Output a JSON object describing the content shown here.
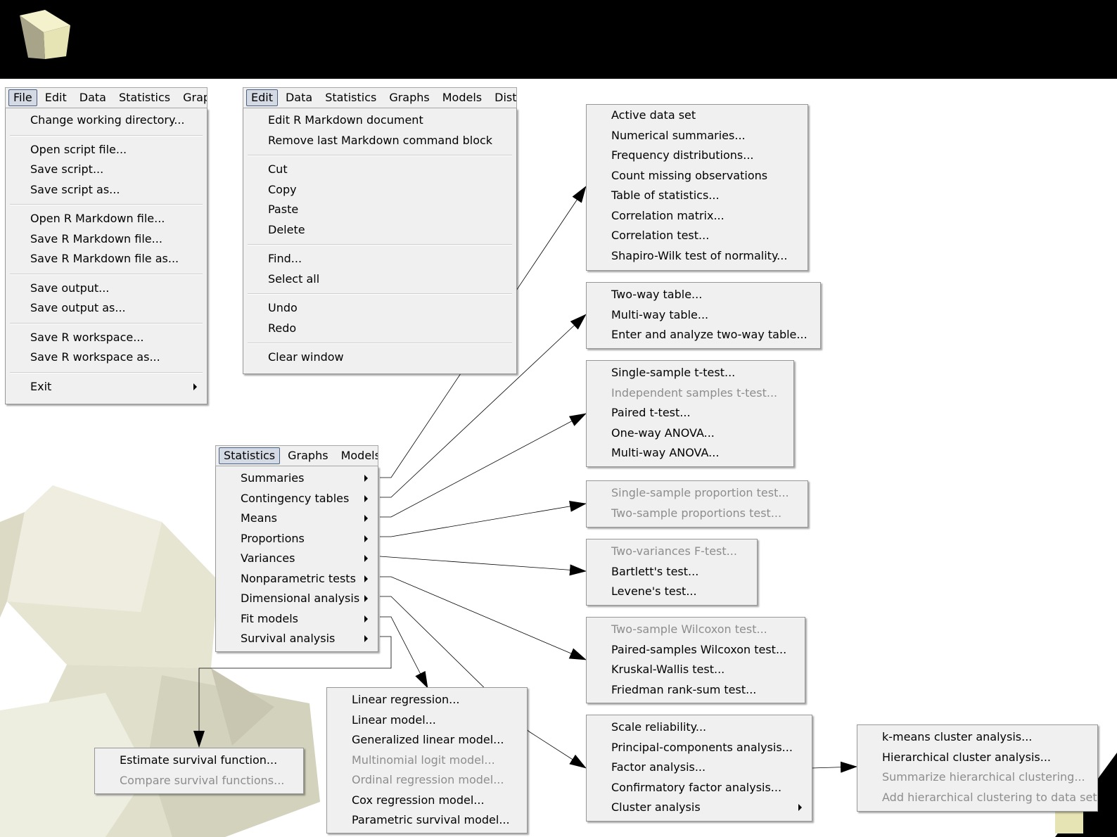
{
  "file_menu": {
    "menubar": [
      "File",
      "Edit",
      "Data",
      "Statistics",
      "Graphs"
    ],
    "items": [
      {
        "label": "Change working directory..."
      },
      {
        "sep": true
      },
      {
        "label": "Open script file..."
      },
      {
        "label": "Save script..."
      },
      {
        "label": "Save script as..."
      },
      {
        "sep": true
      },
      {
        "label": "Open R Markdown file..."
      },
      {
        "label": "Save R Markdown file..."
      },
      {
        "label": "Save R Markdown file as..."
      },
      {
        "sep": true
      },
      {
        "label": "Save output..."
      },
      {
        "label": "Save output as..."
      },
      {
        "sep": true
      },
      {
        "label": "Save R workspace..."
      },
      {
        "label": "Save R workspace as..."
      },
      {
        "sep": true
      },
      {
        "label": "Exit",
        "submenu": true
      }
    ]
  },
  "edit_menu": {
    "menubar": [
      "Edit",
      "Data",
      "Statistics",
      "Graphs",
      "Models",
      "Distributions"
    ],
    "items": [
      {
        "label": "Edit R Markdown document"
      },
      {
        "label": "Remove last Markdown command block"
      },
      {
        "sep": true
      },
      {
        "label": "Cut"
      },
      {
        "label": "Copy"
      },
      {
        "label": "Paste"
      },
      {
        "label": "Delete"
      },
      {
        "sep": true
      },
      {
        "label": "Find..."
      },
      {
        "label": "Select all"
      },
      {
        "sep": true
      },
      {
        "label": "Undo"
      },
      {
        "label": "Redo"
      },
      {
        "sep": true
      },
      {
        "label": "Clear window"
      }
    ]
  },
  "statistics_menu": {
    "menubar": [
      "Statistics",
      "Graphs",
      "Models"
    ],
    "items": [
      {
        "label": "Summaries",
        "submenu": true
      },
      {
        "label": "Contingency tables",
        "submenu": true
      },
      {
        "label": "Means",
        "submenu": true
      },
      {
        "label": "Proportions",
        "submenu": true
      },
      {
        "label": "Variances",
        "submenu": true
      },
      {
        "label": "Nonparametric tests",
        "submenu": true
      },
      {
        "label": "Dimensional analysis",
        "submenu": true
      },
      {
        "label": "Fit models",
        "submenu": true
      },
      {
        "label": "Survival analysis",
        "submenu": true
      }
    ]
  },
  "submenus": {
    "summaries": [
      {
        "label": "Active data set"
      },
      {
        "label": "Numerical summaries..."
      },
      {
        "label": "Frequency distributions..."
      },
      {
        "label": "Count missing observations"
      },
      {
        "label": "Table of statistics..."
      },
      {
        "label": "Correlation matrix..."
      },
      {
        "label": "Correlation test..."
      },
      {
        "label": "Shapiro-Wilk test of normality..."
      }
    ],
    "contingency": [
      {
        "label": "Two-way table..."
      },
      {
        "label": "Multi-way table..."
      },
      {
        "label": "Enter and analyze two-way table..."
      }
    ],
    "means": [
      {
        "label": "Single-sample t-test..."
      },
      {
        "label": "Independent samples t-test...",
        "disabled": true
      },
      {
        "label": "Paired t-test..."
      },
      {
        "label": "One-way ANOVA..."
      },
      {
        "label": "Multi-way ANOVA..."
      }
    ],
    "proportions": [
      {
        "label": "Single-sample proportion test...",
        "disabled": true
      },
      {
        "label": "Two-sample proportions test...",
        "disabled": true
      }
    ],
    "variances": [
      {
        "label": "Two-variances F-test...",
        "disabled": true
      },
      {
        "label": "Bartlett's test..."
      },
      {
        "label": "Levene's test..."
      }
    ],
    "nonparametric": [
      {
        "label": "Two-sample Wilcoxon test...",
        "disabled": true
      },
      {
        "label": "Paired-samples Wilcoxon test..."
      },
      {
        "label": "Kruskal-Wallis test..."
      },
      {
        "label": "Friedman rank-sum test..."
      }
    ],
    "dimensional": [
      {
        "label": "Scale reliability..."
      },
      {
        "label": "Principal-components analysis..."
      },
      {
        "label": "Factor analysis..."
      },
      {
        "label": "Confirmatory factor analysis..."
      },
      {
        "label": "Cluster analysis",
        "submenu": true
      }
    ],
    "cluster": [
      {
        "label": "k-means cluster analysis..."
      },
      {
        "label": "Hierarchical cluster analysis..."
      },
      {
        "label": "Summarize hierarchical clustering...",
        "disabled": true
      },
      {
        "label": "Add hierarchical clustering to data set...",
        "disabled": true
      }
    ],
    "fit_models": [
      {
        "label": "Linear regression..."
      },
      {
        "label": "Linear model..."
      },
      {
        "label": "Generalized linear model..."
      },
      {
        "label": "Multinomial logit model...",
        "disabled": true
      },
      {
        "label": "Ordinal regression model...",
        "disabled": true
      },
      {
        "label": "Cox regression model..."
      },
      {
        "label": "Parametric survival model..."
      }
    ],
    "survival": [
      {
        "label": "Estimate survival function..."
      },
      {
        "label": "Compare survival functions...",
        "disabled": true
      }
    ]
  },
  "colors": {
    "menu_bg": "#f0f0f0",
    "disabled_text": "#8d8d8d",
    "banner": "#000000"
  }
}
